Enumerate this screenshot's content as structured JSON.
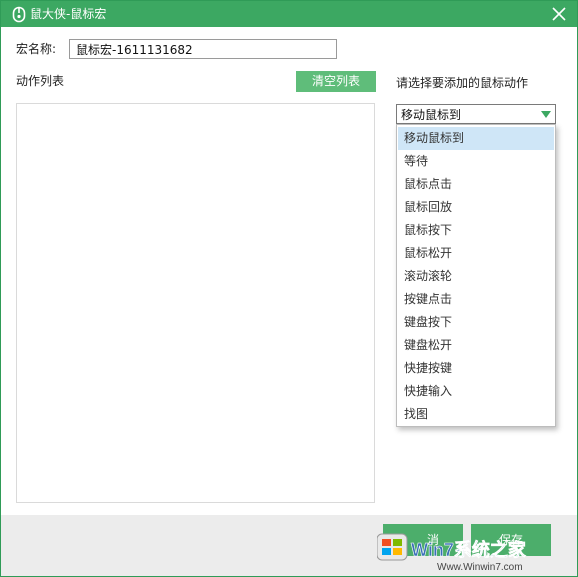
{
  "window": {
    "title": "鼠大侠-鼠标宏",
    "colors": {
      "title_bar": "#3ca862",
      "accent_button": "#5fbd7a",
      "selected_item": "#cfe6f7",
      "footer": "#ececec"
    }
  },
  "form": {
    "name_label": "宏名称:",
    "name_value": "鼠标宏-1611131682",
    "action_list_label": "动作列表",
    "clear_button": "清空列表",
    "select_prompt": "请选择要添加的鼠标动作",
    "select_value": "移动鼠标到"
  },
  "dropdown": {
    "items": [
      "移动鼠标到",
      "等待",
      "鼠标点击",
      "鼠标回放",
      "鼠标按下",
      "鼠标松开",
      "滚动滚轮",
      "按键点击",
      "键盘按下",
      "键盘松开",
      "快捷按键",
      "快捷输入",
      "找图"
    ],
    "selected_index": 0
  },
  "footer": {
    "button_left_fragment": "消",
    "button_right_fragment": "保存"
  },
  "watermark": {
    "logo_text": "Win7系统之家",
    "url": "Www.Winwin7.com"
  }
}
